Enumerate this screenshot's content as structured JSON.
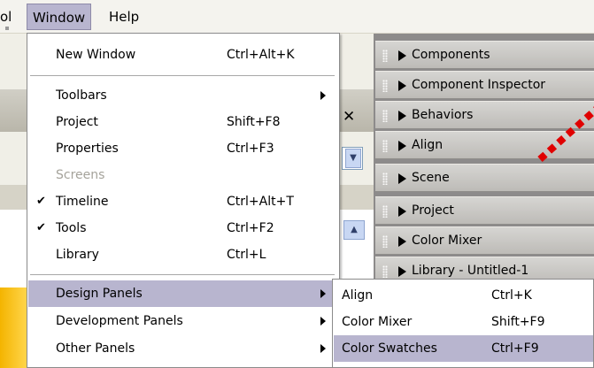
{
  "menubar": {
    "items": [
      {
        "label": "ol",
        "id": "tool"
      },
      {
        "label": "Window",
        "id": "window"
      },
      {
        "label": "Help",
        "id": "help"
      }
    ]
  },
  "window_menu": {
    "items": [
      {
        "label": "New Window",
        "shortcut": "Ctrl+Alt+K"
      },
      {
        "label": "Toolbars"
      },
      {
        "label": "Project",
        "shortcut": "Shift+F8"
      },
      {
        "label": "Properties",
        "shortcut": "Ctrl+F3"
      },
      {
        "label": "Screens"
      },
      {
        "label": "Timeline",
        "shortcut": "Ctrl+Alt+T",
        "check": "✔"
      },
      {
        "label": "Tools",
        "shortcut": "Ctrl+F2",
        "check": "✔"
      },
      {
        "label": "Library",
        "shortcut": "Ctrl+L"
      },
      {
        "label": "Design Panels"
      },
      {
        "label": "Development Panels"
      },
      {
        "label": "Other Panels"
      }
    ]
  },
  "design_panels_submenu": {
    "items": [
      {
        "label": "Align",
        "shortcut": "Ctrl+K"
      },
      {
        "label": "Color Mixer",
        "shortcut": "Shift+F9"
      },
      {
        "label": "Color Swatches",
        "shortcut": "Ctrl+F9"
      }
    ]
  },
  "panels": {
    "items": [
      {
        "label": "Components"
      },
      {
        "label": "Component Inspector"
      },
      {
        "label": "Behaviors"
      },
      {
        "label": "Align"
      },
      {
        "label": "Scene"
      },
      {
        "label": "Project"
      },
      {
        "label": "Color Mixer"
      },
      {
        "label": "Library - Untitled-1"
      }
    ]
  },
  "background": {
    "close_glyph": "✕",
    "dropdown_glyph": "▼",
    "scroll_up_glyph": "▲"
  },
  "colors": {
    "menu_highlight": "#b8b5cf",
    "panel_bg": "#8d8b8b",
    "annotation_red": "#e00000",
    "disabled_text": "#a5a39b"
  }
}
